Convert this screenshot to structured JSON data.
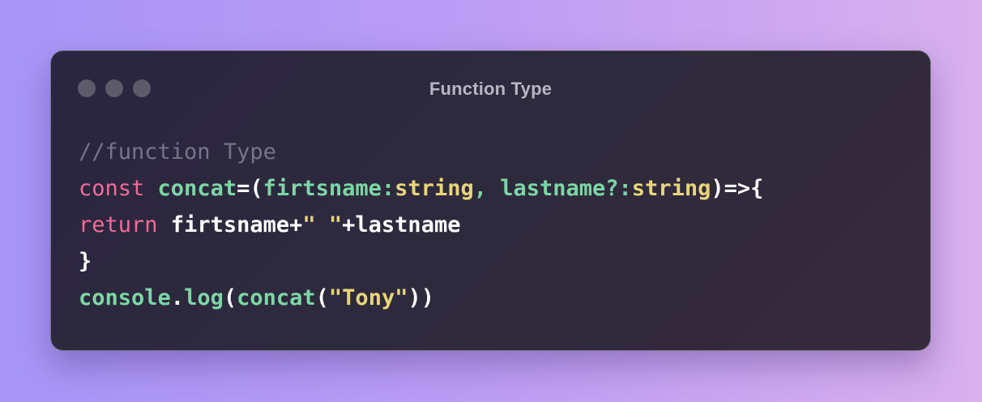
{
  "window": {
    "title": "Function Type",
    "dots": [
      "window-dot",
      "window-dot",
      "window-dot"
    ]
  },
  "code": {
    "line1": {
      "comment": "//function Type"
    },
    "line2": {
      "kw": "const",
      "sp1": " ",
      "fn": "concat",
      "op1": "=(",
      "param1": "firtsname:",
      "type1": "string",
      "comma": ", ",
      "param2": "lastname?:",
      "type2": "string",
      "close": ")=>{"
    },
    "line3": {
      "kw": "return",
      "sp": " ",
      "expr1": "firtsname+",
      "str": "\" \"",
      "expr2": "+lastname"
    },
    "line4": {
      "brace": "}"
    },
    "line5": {
      "obj": "console",
      "dot": ".",
      "method": "log",
      "open1": "(",
      "fn": "concat",
      "open2": "(",
      "str": "\"Tony\"",
      "close": "))"
    }
  },
  "colors": {
    "keyword": "#f06b97",
    "identifier": "#7dd6a4",
    "string": "#e8d57a",
    "comment": "#77738a",
    "plain": "#ffffff"
  }
}
